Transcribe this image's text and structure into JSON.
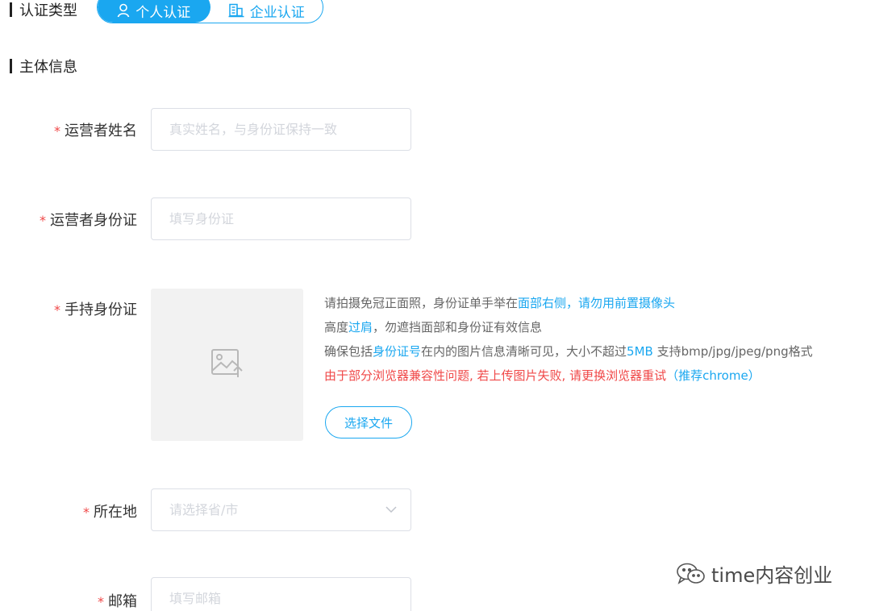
{
  "certification": {
    "section_title": "认证类型",
    "options": [
      {
        "label": "个人认证",
        "active": true
      },
      {
        "label": "企业认证",
        "active": false
      }
    ]
  },
  "subject": {
    "section_title": "主体信息"
  },
  "form": {
    "required_mark": "*",
    "operator_name": {
      "label": "运营者姓名",
      "placeholder": "真实姓名，与身份证保持一致",
      "value": ""
    },
    "operator_id": {
      "label": "运营者身份证",
      "placeholder": "填写身份证",
      "value": ""
    },
    "handheld_id": {
      "label": "手持身份证",
      "instructions": {
        "line1_a": "请拍摄免冠正面照，身份证单手举在",
        "line1_b": "面部右侧，请勿用前置摄像头",
        "line2_a": "高度",
        "line2_b": "过肩",
        "line2_c": "，勿遮挡面部和身份证有效信息",
        "line3_a": "确保包括",
        "line3_b": "身份证号",
        "line3_c": "在内的图片信息清晰可见，大小不超过",
        "line3_d": "5MB",
        "line3_e": " 支持bmp/jpg/jpeg/png格式",
        "line4_a": "由于部分浏览器兼容性问题, 若上传图片失败, 请更换浏览器重试",
        "line4_b": "（推荐chrome）"
      },
      "button_label": "选择文件"
    },
    "location": {
      "label": "所在地",
      "placeholder": "请选择省/市"
    },
    "email": {
      "label": "邮箱",
      "placeholder": "填写邮箱",
      "value": ""
    }
  },
  "watermark": {
    "text": "time内容创业"
  },
  "colors": {
    "accent": "#1aa7f0",
    "required": "#f04848",
    "upload_bg": "#f2f2f2",
    "border": "#dcdfe6"
  },
  "icons": {
    "personal": "user-icon",
    "enterprise": "building-icon",
    "upload": "image-upload-icon",
    "select": "chevron-down-icon",
    "watermark": "wechat-icon"
  }
}
